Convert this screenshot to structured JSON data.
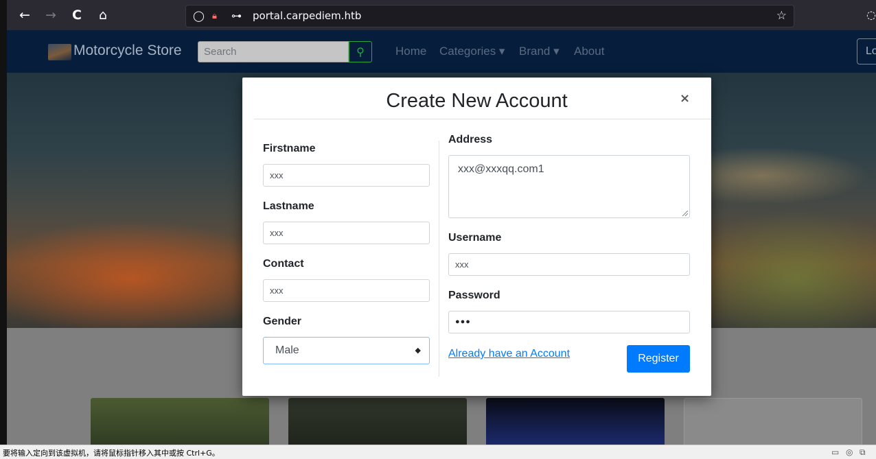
{
  "browser": {
    "back_icon": "←",
    "forward_icon": "→",
    "reload_icon": "C",
    "home_icon": "⌂",
    "shield_icon": "◯",
    "lock_icon": "🔒︎",
    "key_icon": "⊶",
    "url": "portal.carpediem.htb",
    "star_icon": "☆",
    "pocket_icon": "◌"
  },
  "site": {
    "brand": "Motorcycle Store",
    "search_placeholder": "Search",
    "search_icon": "⚲",
    "nav": {
      "home": "Home",
      "categories": "Categories ▾",
      "brand": "Brand ▾",
      "about": "About"
    },
    "login_label": "Lo"
  },
  "modal": {
    "title": "Create New Account",
    "close_icon": "×",
    "firstname_label": "Firstname",
    "firstname_value": "xxx",
    "lastname_label": "Lastname",
    "lastname_value": "xxx",
    "contact_label": "Contact",
    "contact_value": "xxx",
    "gender_label": "Gender",
    "gender_value": "Male",
    "gender_arrow": "◆",
    "address_label": "Address",
    "address_value": "xxx@xxxqq.com1",
    "username_label": "Username",
    "username_value": "xxx",
    "password_label": "Password",
    "password_value": "●●●",
    "login_link": "Already have an Account",
    "register_button": "Register"
  },
  "vm_status": {
    "message": "要将输入定向到该虚拟机，请将鼠标指针移入其中或按 Ctrl+G。",
    "icons": [
      "▭",
      "◎",
      "⧉"
    ]
  }
}
